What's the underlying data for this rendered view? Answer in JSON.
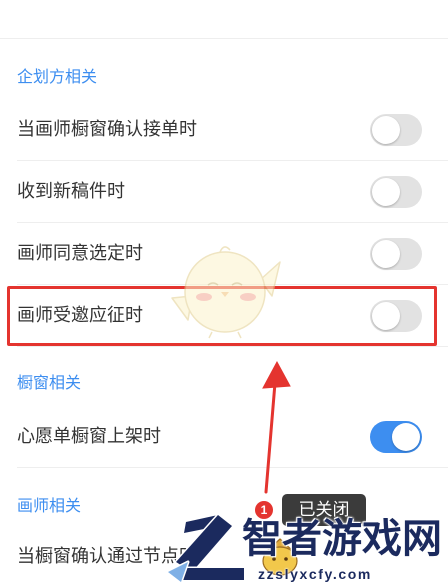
{
  "sections": [
    {
      "title": "企划方相关",
      "items": [
        {
          "label": "当画师橱窗确认接单时",
          "enabled": false
        },
        {
          "label": "收到新稿件时",
          "enabled": false
        },
        {
          "label": "画师同意选定时",
          "enabled": false
        },
        {
          "label": "画师受邀应征时",
          "enabled": false,
          "highlighted": true
        }
      ]
    },
    {
      "title": "橱窗相关",
      "items": [
        {
          "label": "心愿单橱窗上架时",
          "enabled": true
        }
      ]
    },
    {
      "title": "画师相关",
      "items": [
        {
          "label": "当橱窗确认通过节点时"
        }
      ]
    }
  ],
  "annotation": {
    "step_number": "1",
    "tooltip": "已关闭"
  },
  "watermark": {
    "brand": "智者游戏网",
    "domain": "zzslyxcfy.com"
  },
  "colors": {
    "accent": "#3d8ef0",
    "highlight": "#e4342f",
    "toggle_off": "#e2e2e2",
    "tooltip_bg": "#3b3b3b",
    "watermark": "#1b2a5e",
    "text": "#333333",
    "divider": "#eeeeee"
  }
}
